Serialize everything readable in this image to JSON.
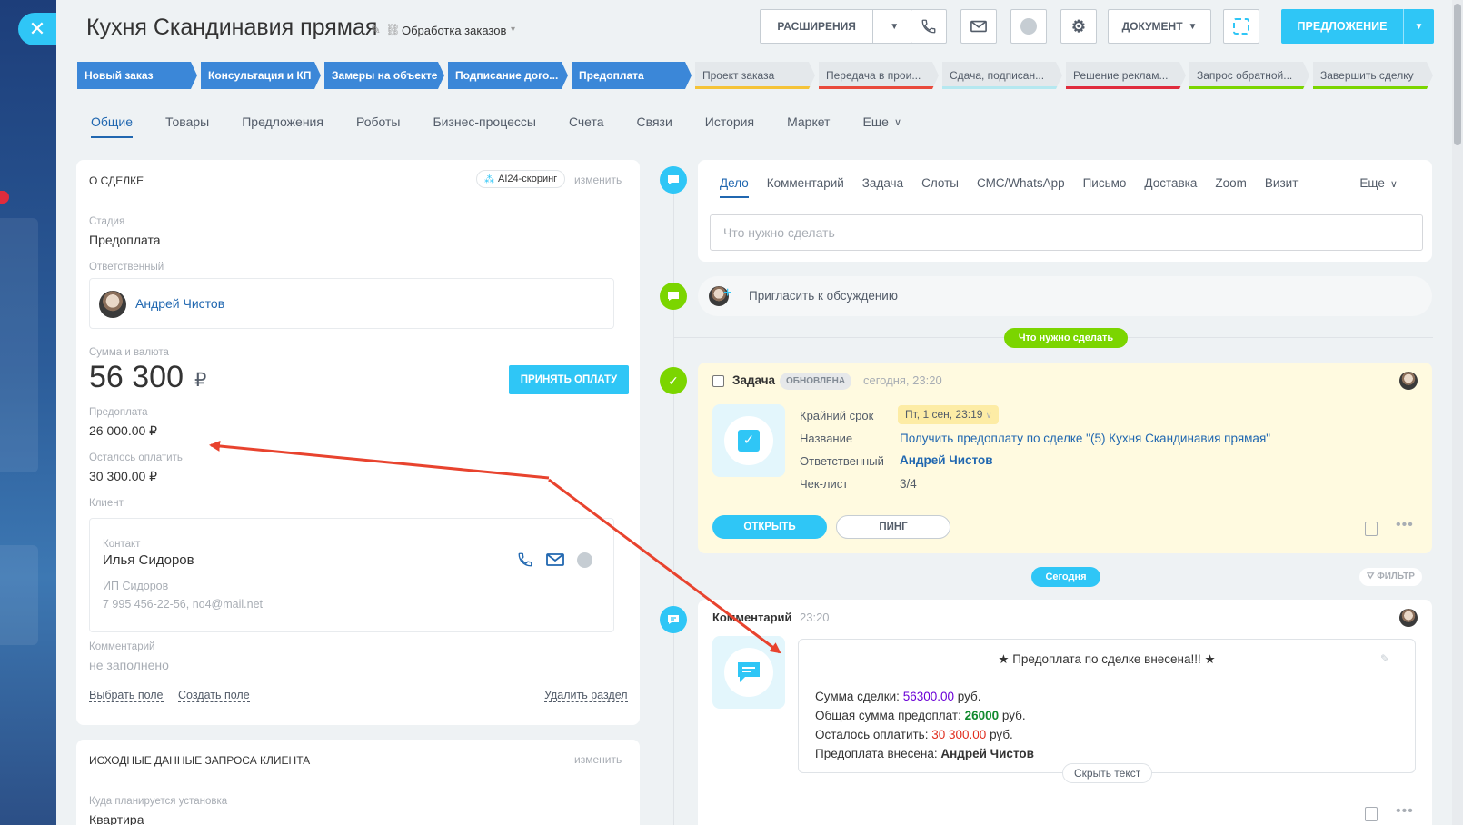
{
  "header": {
    "title": "Кухня Скандинавия прямая",
    "funnel": "Обработка заказов",
    "extensions_label": "РАСШИРЕНИЯ",
    "document_label": "ДОКУМЕНТ",
    "offer_label": "ПРЕДЛОЖЕНИЕ"
  },
  "stages": [
    {
      "label": "Новый заказ",
      "done": true,
      "color": "#3b87d8"
    },
    {
      "label": "Консультация и КП",
      "done": true,
      "color": "#3b87d8"
    },
    {
      "label": "Замеры на объекте",
      "done": true,
      "color": "#3b87d8"
    },
    {
      "label": "Подписание дого...",
      "done": true,
      "color": "#3b87d8"
    },
    {
      "label": "Предоплата",
      "done": true,
      "color": "#3b87d8"
    },
    {
      "label": "Проект заказа",
      "done": false,
      "color": "#f5c338"
    },
    {
      "label": "Передача в прои...",
      "done": false,
      "color": "#e94a3c"
    },
    {
      "label": "Сдача, подписан...",
      "done": false,
      "color": "#b5e8f0"
    },
    {
      "label": "Решение реклам...",
      "done": false,
      "color": "#e02c3d"
    },
    {
      "label": "Запрос обратной...",
      "done": false,
      "color": "#7bd500"
    },
    {
      "label": "Завершить сделку",
      "done": false,
      "color": "#7bd500"
    }
  ],
  "tabs": [
    "Общие",
    "Товары",
    "Предложения",
    "Роботы",
    "Бизнес-процессы",
    "Счета",
    "Связи",
    "История",
    "Маркет",
    "Еще"
  ],
  "about": {
    "section_title": "О СДЕЛКЕ",
    "ai_badge": "AI24-скоринг",
    "edit": "изменить",
    "stage_label": "Стадия",
    "stage_value": "Предоплата",
    "responsible_label": "Ответственный",
    "responsible_name": "Андрей Чистов",
    "amount_label": "Сумма и валюта",
    "amount_value": "56 300",
    "currency": "₽",
    "accept_payment": "ПРИНЯТЬ ОПЛАТУ",
    "prepay_label": "Предоплата",
    "prepay_value": "26 000.00 ₽",
    "remaining_label": "Осталось оплатить",
    "remaining_value": "30 300.00 ₽",
    "client_label": "Клиент",
    "contact_label": "Контакт",
    "contact_name": "Илья Сидоров",
    "company": "ИП Сидоров",
    "contact_details": "7 995 456-22-56, no4@mail.net",
    "comment_label": "Комментарий",
    "comment_value": "не заполнено",
    "choose_field": "Выбрать поле",
    "create_field": "Создать поле",
    "delete_section": "Удалить раздел"
  },
  "source": {
    "section_title": "ИСХОДНЫЕ ДАННЫЕ ЗАПРОСА КЛИЕНТА",
    "edit": "изменить",
    "install_label": "Куда планируется установка",
    "install_value": "Квартира"
  },
  "timeline": {
    "composer_tabs": [
      "Дело",
      "Комментарий",
      "Задача",
      "Слоты",
      "СМС/WhatsApp",
      "Письмо",
      "Доставка",
      "Zoom",
      "Визит",
      "Еще"
    ],
    "composer_placeholder": "Что нужно сделать",
    "invite_text": "Пригласить к обсуждению",
    "todo_pill": "Что нужно сделать",
    "task": {
      "title": "Задача",
      "status": "ОБНОВЛЕНА",
      "time": "сегодня, 23:20",
      "deadline_label": "Крайний срок",
      "deadline_value": "Пт, 1 сен, 23:19",
      "name_label": "Название",
      "name_value": "Получить предоплату по сделке \"(5) Кухня Скандинавия прямая\"",
      "resp_label": "Ответственный",
      "resp_value": "Андрей Чистов",
      "checklist_label": "Чек-лист",
      "checklist_value": "3/4",
      "open_btn": "ОТКРЫТЬ",
      "ping_btn": "ПИНГ"
    },
    "today_pill": "Сегодня",
    "filter": "ФИЛЬТР",
    "comment": {
      "title": "Комментарий",
      "time": "23:20",
      "heading": "★ Предоплата по сделке внесена!!! ★",
      "line1_label": "Сумма сделки:",
      "line1_value": "56300.00",
      "line1_unit": "руб.",
      "line2_label": "Общая сумма предоплат:",
      "line2_value": "26000",
      "line2_unit": "руб.",
      "line3_label": "Осталось оплатить:",
      "line3_value": "30 300.00",
      "line3_unit": "руб.",
      "line4_label": "Предоплата внесена:",
      "line4_value": "Андрей Чистов",
      "hide_text": "Скрыть текст"
    }
  }
}
